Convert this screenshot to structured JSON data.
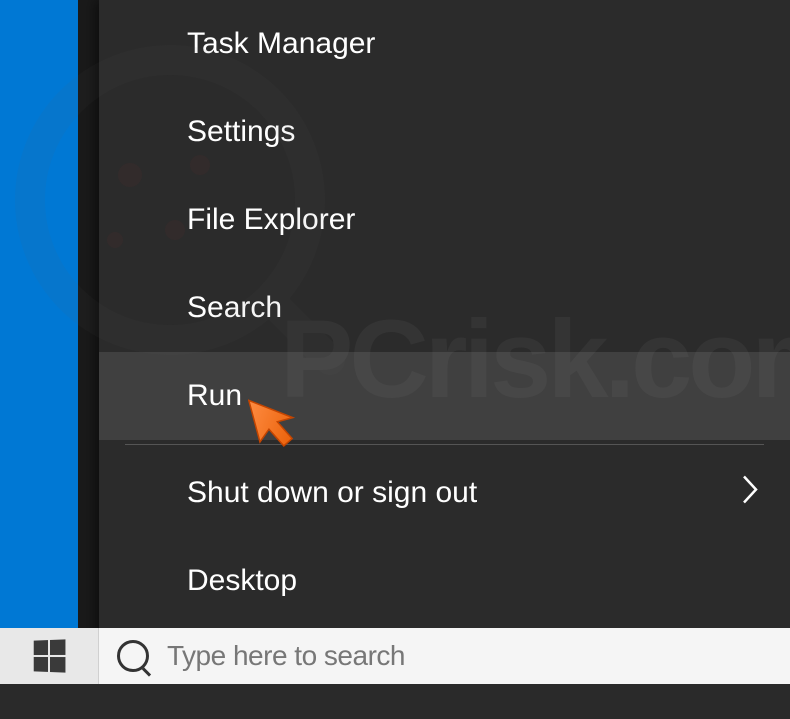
{
  "menu": {
    "items": [
      {
        "label": "Task Manager",
        "highlighted": false,
        "hasSubmenu": false
      },
      {
        "label": "Settings",
        "highlighted": false,
        "hasSubmenu": false
      },
      {
        "label": "File Explorer",
        "highlighted": false,
        "hasSubmenu": false
      },
      {
        "label": "Search",
        "highlighted": false,
        "hasSubmenu": false
      },
      {
        "label": "Run",
        "highlighted": true,
        "hasSubmenu": false
      }
    ],
    "bottomItems": [
      {
        "label": "Shut down or sign out",
        "highlighted": false,
        "hasSubmenu": true
      },
      {
        "label": "Desktop",
        "highlighted": false,
        "hasSubmenu": false
      }
    ]
  },
  "taskbar": {
    "searchPlaceholder": "Type here to search"
  },
  "watermark": {
    "text": "PCrisk.com"
  }
}
